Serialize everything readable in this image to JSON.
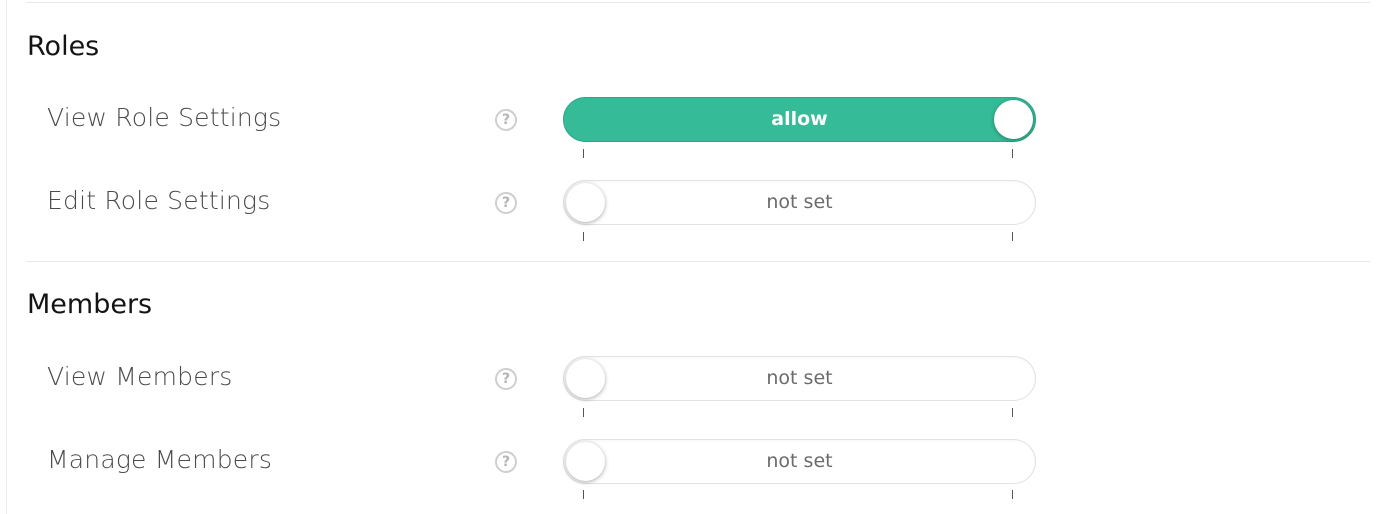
{
  "sections": [
    {
      "title": "Roles",
      "permissions": [
        {
          "label": "View Role Settings",
          "help": "?",
          "state": "allow"
        },
        {
          "label": "Edit Role Settings",
          "help": "?",
          "state": "not set"
        }
      ]
    },
    {
      "title": "Members",
      "permissions": [
        {
          "label": "View Members",
          "help": "?",
          "state": "not set"
        },
        {
          "label": "Manage Members",
          "help": "?",
          "state": "not set"
        }
      ]
    }
  ],
  "colors": {
    "allow": "#36bb98",
    "not_set_background": "#ffffff",
    "label": "#4a4a4a"
  },
  "icons": {
    "help": "question-circle-icon"
  }
}
